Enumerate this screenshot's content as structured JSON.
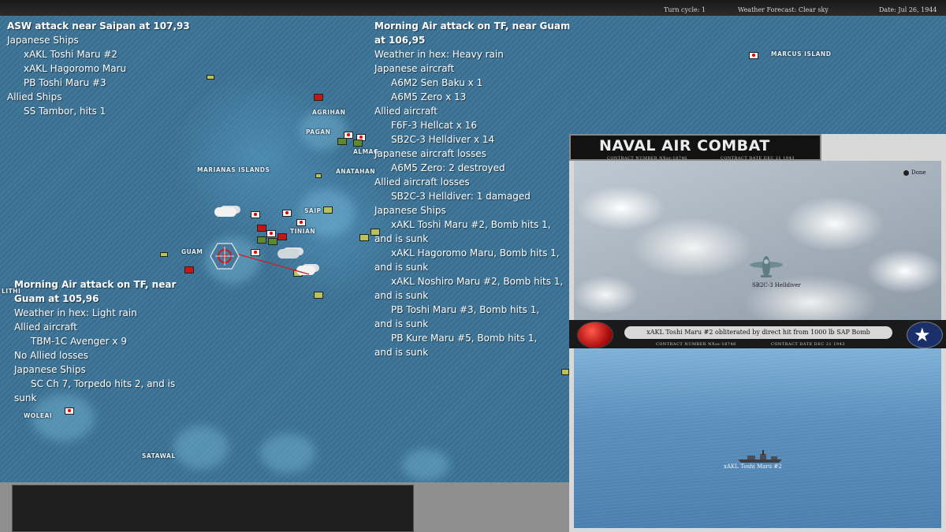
{
  "topbar": {
    "turn_cycle": "Turn cycle: 1",
    "weather": "Weather Forecast: Clear sky",
    "date": "Date: Jul 26, 1944"
  },
  "map": {
    "places": {
      "marcus": "MARCUS ISLAND",
      "agrihan": "AGRIHAN",
      "pagan": "PAGAN",
      "almagan": "ALMAG",
      "marianas": "MARIANAS ISLANDS",
      "anatahan": "ANATAHAN",
      "saipan": "SAIP",
      "tinian": "TINIAN",
      "guam": "GUAM",
      "lithi": "LITHI",
      "woleai": "WOLEAI",
      "satawal": "SATAWAL"
    }
  },
  "reports": {
    "asw": {
      "title": "ASW attack near Saipan  at 107,93",
      "lines": [
        "Japanese Ships"
      ],
      "ships_jp": [
        "xAKL Toshi Maru #2",
        "xAKL Hagoromo Maru",
        "PB Toshi Maru #3"
      ],
      "allied_header": "Allied Ships",
      "ships_allied": [
        "SS Tambor, hits 1"
      ]
    },
    "air_guam_1": {
      "title": "Morning Air attack on TF, near Guam at 106,95",
      "weather": "Weather in hex: Heavy rain",
      "jp_aircraft_header": "Japanese aircraft",
      "jp_aircraft": [
        "A6M2 Sen Baku x 1",
        "A6M5 Zero x 13"
      ],
      "allied_aircraft_header": "Allied aircraft",
      "allied_aircraft": [
        "F6F-3 Hellcat x 16",
        "SB2C-3 Helldiver x 14"
      ],
      "jp_losses_header": "Japanese aircraft losses",
      "jp_losses": [
        "A6M5 Zero: 2 destroyed"
      ],
      "allied_losses_header": "Allied aircraft losses",
      "allied_losses": [
        "SB2C-3 Helldiver: 1 damaged"
      ],
      "jp_ships_header": "Japanese Ships",
      "jp_ships": [
        {
          "a": "xAKL Toshi Maru #2, Bomb hits 1,",
          "b": "and is sunk"
        },
        {
          "a": "xAKL Hagoromo Maru, Bomb hits 1,",
          "b": "and is sunk"
        },
        {
          "a": "xAKL Noshiro Maru #2, Bomb hits 1,",
          "b": "and is sunk"
        },
        {
          "a": "PB Toshi Maru #3, Bomb hits 1,",
          "b": "and is sunk"
        },
        {
          "a": "PB Kure Maru #5, Bomb hits 1,",
          "b": "and is sunk"
        }
      ]
    },
    "air_guam_2": {
      "title_1": "Morning Air attack on TF, near",
      "title_2": "Guam at 105,96",
      "weather": "Weather in hex: Light rain",
      "allied_aircraft_header": "Allied aircraft",
      "allied_aircraft": [
        "TBM-1C Avenger x 9"
      ],
      "no_losses": "No Allied losses",
      "jp_ships_header": "Japanese Ships",
      "jp_ship_a": "SC Ch 7, Torpedo hits 2, and is",
      "jp_ship_b": "sunk"
    }
  },
  "combat": {
    "title": "NAVAL AIR COMBAT",
    "contract_number": "CONTRACT NUMBER  NXss-18746",
    "contract_date": "CONTRACT DATE  DEC 21 1943",
    "done": "Done",
    "plane_label": "SB2C-3 Helldiver",
    "message": "xAKL Toshi Maru #2 obliterated by direct hit from 1000 lb SAP Bomb",
    "ship_label": "xAKL Toshi Maru #2"
  }
}
